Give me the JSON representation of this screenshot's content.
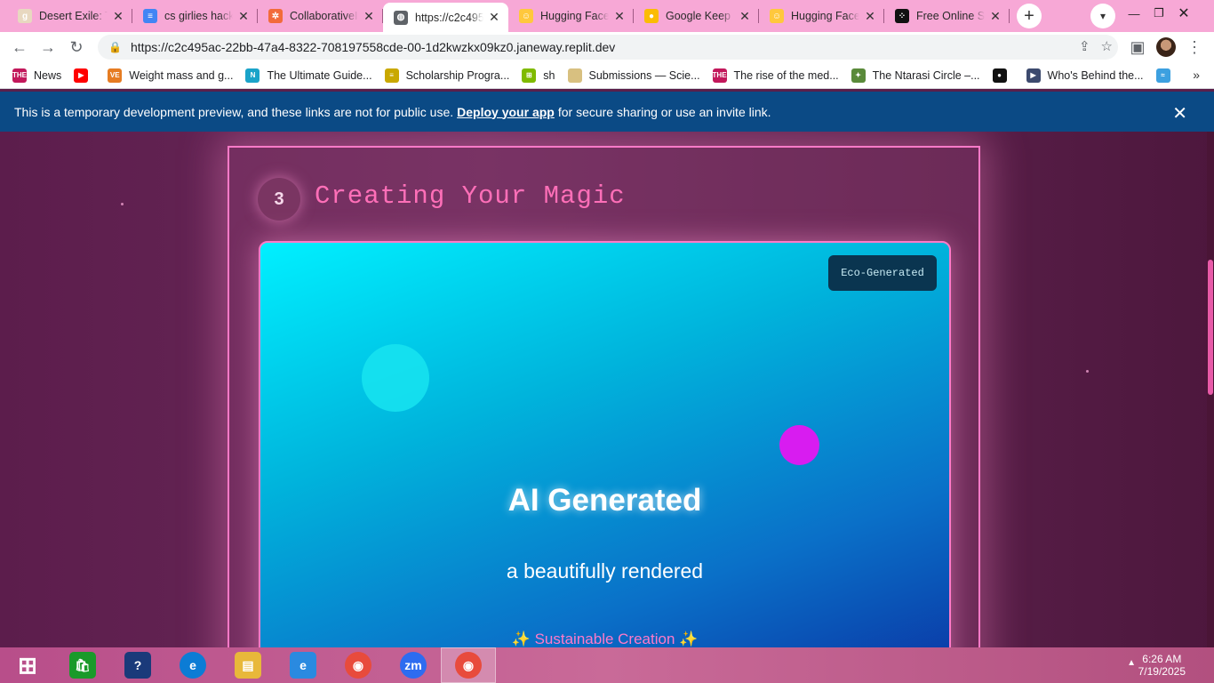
{
  "browser": {
    "tabs": [
      {
        "title": "Desert Exile: Th",
        "icon": "goodreads-icon",
        "fav_text": "g",
        "fav_color": "#e8d8c0"
      },
      {
        "title": "cs girlies hacka",
        "icon": "google-docs-icon",
        "fav_text": "≡",
        "fav_color": "#4285f4"
      },
      {
        "title": "CollaborativeIn",
        "icon": "figma-icon",
        "fav_text": "✲",
        "fav_color": "#f26b3a"
      },
      {
        "title": "https://c2c495",
        "icon": "globe-icon",
        "fav_text": "◍",
        "fav_color": "#5f6368"
      },
      {
        "title": "Hugging Face",
        "icon": "hugging-face-icon",
        "fav_text": "☺",
        "fav_color": "#ffc83d"
      },
      {
        "title": "Google Keep",
        "icon": "google-keep-icon",
        "fav_text": "●",
        "fav_color": "#fbbc04"
      },
      {
        "title": "Hugging Face",
        "icon": "hugging-face-icon",
        "fav_text": "☺",
        "fav_color": "#ffc83d"
      },
      {
        "title": "Free Online Sc",
        "icon": "dice-icon",
        "fav_text": "⁘",
        "fav_color": "#111111"
      }
    ],
    "active_tab": 3,
    "url": "https://c2c495ac-22bb-47a4-8322-708197558cde-00-1d2kwzkx09kz0.janeway.replit.dev",
    "bookmarks": [
      {
        "label": "News",
        "icon": "the-icon",
        "color": "#c2185b",
        "fav_text": "THE"
      },
      {
        "label": "",
        "icon": "youtube-icon",
        "color": "#ff0000",
        "fav_text": "▶"
      },
      {
        "label": "Weight mass and g...",
        "icon": "ve-icon",
        "color": "#e67c22",
        "fav_text": "VE"
      },
      {
        "label": "The Ultimate Guide...",
        "icon": "n-icon",
        "color": "#1aa3c9",
        "fav_text": "N"
      },
      {
        "label": "Scholarship Progra...",
        "icon": "folder-doc-icon",
        "color": "#c9a800",
        "fav_text": "≡"
      },
      {
        "label": "sh",
        "icon": "microsoft-icon",
        "color": "#7fba00",
        "fav_text": "⊞"
      },
      {
        "label": "Submissions — Scie...",
        "icon": "circle-icon",
        "color": "#d8c080",
        "fav_text": ""
      },
      {
        "label": "The rise of the med...",
        "icon": "the-icon",
        "color": "#c2185b",
        "fav_text": "THE"
      },
      {
        "label": "The Ntarasi Circle –...",
        "icon": "figure-icon",
        "color": "#5a8a3a",
        "fav_text": "✦"
      },
      {
        "label": "",
        "icon": "github-icon",
        "color": "#111111",
        "fav_text": "●"
      },
      {
        "label": "Who's Behind the...",
        "icon": "tag-icon",
        "color": "#3c4a6e",
        "fav_text": "▶"
      },
      {
        "label": "",
        "icon": "image-icon",
        "color": "#3ca0e0",
        "fav_text": "≈"
      }
    ]
  },
  "banner": {
    "text_before": "This is a temporary development preview, and these links are not for public use.",
    "link": "Deploy your app",
    "text_after": "for secure sharing or use an invite link."
  },
  "section": {
    "step_number": "3",
    "title": "Creating Your Magic",
    "card": {
      "badge": "Eco-Generated",
      "heading": "AI Generated",
      "subtitle": "a beautifully rendered",
      "sparkle": "✨",
      "footer": "Sustainable Creation"
    }
  },
  "taskbar": {
    "apps": [
      {
        "name": "start-icon",
        "label": "⊞",
        "color": "#ffffff"
      },
      {
        "name": "store-icon",
        "label": "🛍",
        "color": "#1a9a2a"
      },
      {
        "name": "help-icon",
        "label": "?",
        "color": "#1a3a7a"
      },
      {
        "name": "edge-icon",
        "label": "e",
        "color": "#0c7cd5"
      },
      {
        "name": "file-explorer-icon",
        "label": "▤",
        "color": "#e8b83a"
      },
      {
        "name": "internet-explorer-icon",
        "label": "e",
        "color": "#2a8ae0"
      },
      {
        "name": "chrome-icon",
        "label": "◉",
        "color": "#e84b3c"
      },
      {
        "name": "zoom-icon",
        "label": "zm",
        "color": "#2d6cf0"
      },
      {
        "name": "chrome-profile-icon",
        "label": "◉",
        "color": "#e84b3c"
      }
    ],
    "time": "6:26 AM",
    "date": "7/19/2025"
  }
}
